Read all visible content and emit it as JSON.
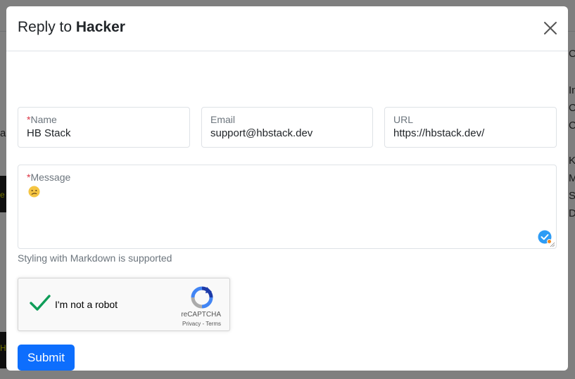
{
  "modal": {
    "title_prefix": "Reply to ",
    "title_name": "Hacker"
  },
  "form": {
    "name": {
      "required_mark": "*",
      "label": "Name",
      "value": "HB Stack"
    },
    "email": {
      "label": "Email",
      "value": "support@hbstack.dev"
    },
    "url": {
      "label": "URL",
      "value": "https://hbstack.dev/"
    },
    "message": {
      "required_mark": "*",
      "label": "Message",
      "value_icon": "confused-face-emoji"
    },
    "help_text": "Styling with Markdown is supported",
    "captcha": {
      "label": "I'm not a robot",
      "brand": "reCAPTCHA",
      "privacy": "Privacy",
      "separator": " - ",
      "terms": "Terms",
      "checked": true
    },
    "submit_label": "Submit"
  },
  "background": {
    "side_letters": [
      "C",
      "In",
      "C",
      "C",
      "K",
      "M",
      "S",
      "D"
    ],
    "left_snippets": [
      "an",
      "e",
      "Ho"
    ]
  },
  "colors": {
    "primary": "#0d6efd",
    "required": "#dc3545",
    "captcha_check": "#0f9d58"
  }
}
